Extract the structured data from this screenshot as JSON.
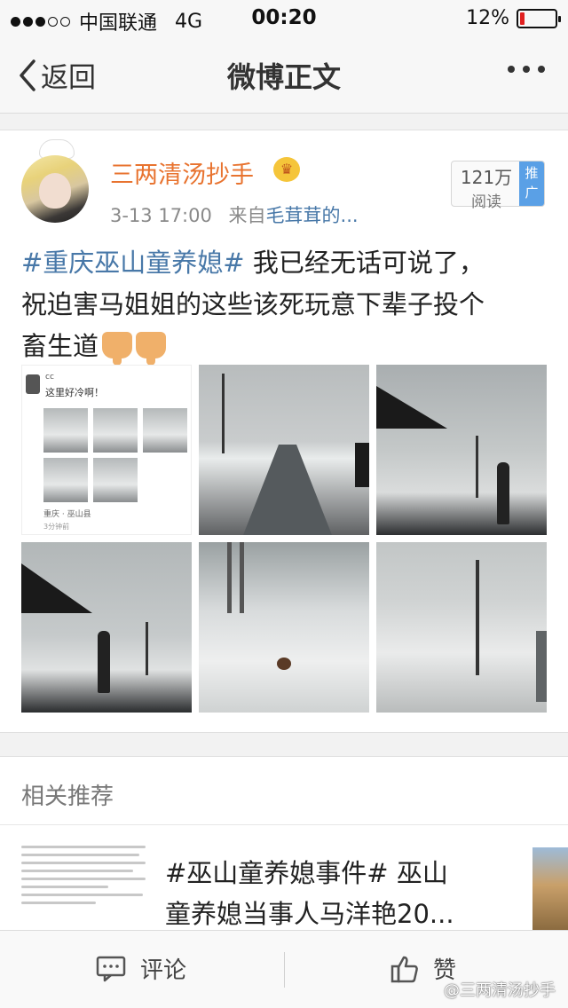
{
  "status_bar": {
    "carrier": "中国联通",
    "network": "4G",
    "time": "00:20",
    "battery": "12%",
    "battery_level": 0.12,
    "signal_bars": 3
  },
  "nav": {
    "back_label": "返回",
    "title": "微博正文"
  },
  "post": {
    "username": "三两清汤抄手",
    "time": "3-13 17:00",
    "source_prefix": "来自",
    "source": "毛茸茸的...",
    "reads_count": "121万",
    "reads_label": "阅读",
    "promo_label_1": "推",
    "promo_label_2": "广",
    "hashtag": "#重庆巫山童养媳#",
    "line1": " 我已经无话可说了，",
    "line2": "祝迫害马姐姐的这些该死玩意下辈子投个",
    "line3": "畜生道",
    "screenshot_name": "cc",
    "screenshot_text": "这里好冷啊！",
    "screenshot_location": "重庆 · 巫山县",
    "screenshot_time": "3分钟前"
  },
  "related": {
    "title": "相关推荐",
    "item_line1": "#巫山童养媳事件# 巫山",
    "item_line2": "童养媳当事人马洋艳20..."
  },
  "bottom": {
    "comment_label": "评论",
    "like_label": "赞",
    "watermark": "@三两清汤抄手"
  },
  "colors": {
    "username": "#e8732f",
    "link": "#4878a8",
    "promo": "#5aa0e6",
    "battery_low": "#e02020"
  }
}
